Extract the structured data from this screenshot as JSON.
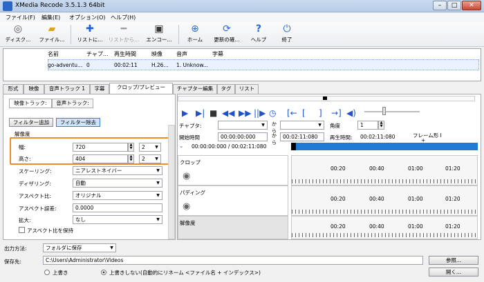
{
  "app": {
    "title": "XMedia Recode 3.5.1.3 64bit"
  },
  "window_controls": {
    "minimize": "–",
    "maximize": "□",
    "close": "✕"
  },
  "menu": [
    "ファイル(F)",
    "編集(E)",
    "オプション(O)",
    "ヘルプ(H)"
  ],
  "toolbar": [
    {
      "label": "ディスク...",
      "icon": "disc-icon",
      "glyph": "◎",
      "enabled": true
    },
    {
      "label": "ファイル...",
      "icon": "folder-open-icon",
      "glyph": "📂",
      "enabled": true
    },
    {
      "label": "リストに...",
      "icon": "add-plus-icon",
      "glyph": "✚",
      "enabled": true
    },
    {
      "label": "リストから...",
      "icon": "remove-minus-icon",
      "glyph": "━",
      "enabled": false
    },
    {
      "label": "エンコー...",
      "icon": "film-encode-icon",
      "glyph": "🎞",
      "enabled": true
    },
    {
      "label": "ホーム",
      "icon": "globe-icon",
      "glyph": "⊕",
      "enabled": true
    },
    {
      "label": "更新の確...",
      "icon": "refresh-icon",
      "glyph": "⟳",
      "enabled": true
    },
    {
      "label": "ヘルプ",
      "icon": "help-question-icon",
      "glyph": "?",
      "enabled": true
    },
    {
      "label": "終了",
      "icon": "power-exit-icon",
      "glyph": "⏻",
      "enabled": true
    }
  ],
  "file_list": {
    "headers": [
      "名前",
      "チャプ...",
      "再生時間",
      "映像",
      "音声",
      "字幕"
    ],
    "rows": [
      [
        "go-adventu...",
        "0",
        "00:02:11",
        "H.26...",
        "1. Unknow...",
        ""
      ]
    ]
  },
  "tabs": [
    "形式",
    "映像",
    "音声トラック 1",
    "字幕",
    "クロップ/プレビュー",
    "チャプター編集",
    "タグ",
    "リスト"
  ],
  "active_tab": "クロップ/プレビュー",
  "left": {
    "subtabs": [
      "映像トラック:",
      "音声トラック:"
    ],
    "add_filter": "フィルター追加",
    "remove_filter": "フィルター除去",
    "resolution_label": "解像度",
    "width_label": "幅:",
    "width_value": "720",
    "width_step": "2",
    "height_label": "高さ:",
    "height_value": "404",
    "height_step": "2",
    "scaling_label": "スケーリング:",
    "scaling_value": "ニアレストネイバー",
    "dithering_label": "ディザリング:",
    "dithering_value": "自動",
    "aspect_label": "アスペクト比:",
    "aspect_value": "オリジナル",
    "aspect_error_label": "アスペクト誤差:",
    "aspect_error_value": "0.0000",
    "zoom_label": "拡大:",
    "zoom_value": "なし",
    "keep_aspect": "アスペクト比を保持"
  },
  "right": {
    "chapter_label": "チャプタ:",
    "to1": "から",
    "angle_label": "角度",
    "angle_value": "1",
    "start_label": "開始時間",
    "start_value": "00:00:00:000",
    "to2": "から",
    "end_value": "00:02:11:080",
    "duration_label": "再生時間:",
    "duration_value": "00:02:11:080",
    "frame_label": "フレーム形 I",
    "frame_label2": "+",
    "position_text": "00:00:00:000 / 00:02:11:080",
    "track_crop": "クロップ",
    "track_padding": "パディング",
    "track_resolution": "解像度",
    "ticks": [
      "00:20",
      "00:40",
      "01:00",
      "01:20"
    ]
  },
  "bottom": {
    "output_label": "出力方法:",
    "output_value": "フォルダに保存",
    "save_label": "保存先:",
    "save_path": "C:\\Users\\Administrator\\Videos",
    "browse": "参照...",
    "overwrite": "上書き",
    "no_overwrite": "上書きしない(自動的にリネーム <ファイル名 + インデックス>)",
    "open": "開く..."
  }
}
